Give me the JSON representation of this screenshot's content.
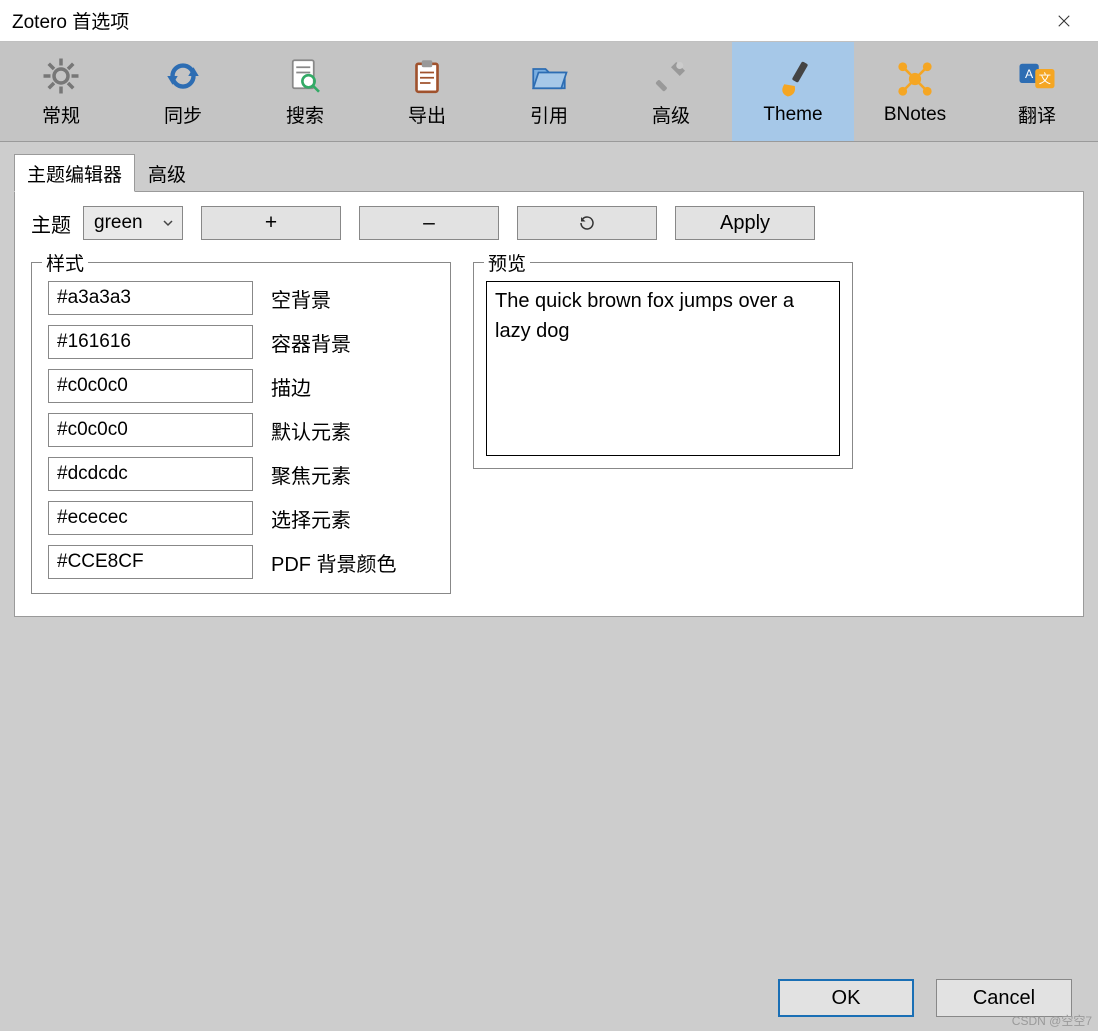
{
  "window": {
    "title": "Zotero 首选项"
  },
  "toolbar": [
    {
      "id": "general",
      "label": "常规"
    },
    {
      "id": "sync",
      "label": "同步"
    },
    {
      "id": "search",
      "label": "搜索"
    },
    {
      "id": "export",
      "label": "导出"
    },
    {
      "id": "cite",
      "label": "引用"
    },
    {
      "id": "advanced",
      "label": "高级"
    },
    {
      "id": "theme",
      "label": "Theme",
      "selected": true
    },
    {
      "id": "bnotes",
      "label": "BNotes"
    },
    {
      "id": "translate",
      "label": "翻译"
    }
  ],
  "subtabs": [
    {
      "id": "editor",
      "label": "主题编辑器",
      "active": true
    },
    {
      "id": "advanced",
      "label": "高级"
    }
  ],
  "theme_row": {
    "label": "主题",
    "selected": "green",
    "add": "+",
    "remove": "–",
    "refresh": "↻",
    "apply": "Apply"
  },
  "styles": {
    "legend": "样式",
    "rows": [
      {
        "value": "#a3a3a3",
        "label": "空背景"
      },
      {
        "value": "#161616",
        "label": "容器背景"
      },
      {
        "value": "#c0c0c0",
        "label": "描边"
      },
      {
        "value": "#c0c0c0",
        "label": "默认元素"
      },
      {
        "value": "#dcdcdc",
        "label": "聚焦元素"
      },
      {
        "value": "#ececec",
        "label": "选择元素"
      },
      {
        "value": "#CCE8CF",
        "label": "PDF 背景颜色"
      }
    ]
  },
  "preview": {
    "legend": "预览",
    "text": "The quick brown fox jumps over a lazy dog"
  },
  "footer": {
    "ok": "OK",
    "cancel": "Cancel"
  },
  "watermark": "CSDN @空空7"
}
